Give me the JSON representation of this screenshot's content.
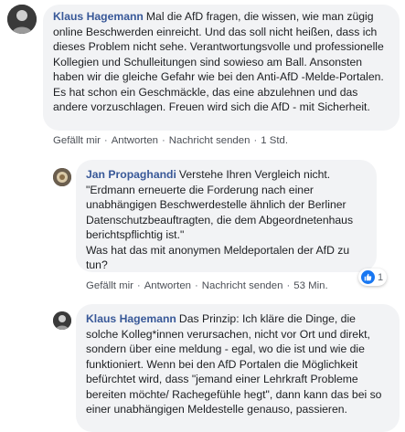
{
  "comments": [
    {
      "author": "Klaus Hagemann",
      "text": "Mal die AfD fragen, die wissen, wie man zügig online Beschwerden einreicht. Und das soll nicht heißen, dass ich dieses Problem nicht sehe. Verantwortungsvolle und professionelle Kollegien und Schulleitungen sind sowieso am Ball. Ansonsten haben wir die gleiche Gefahr wie bei den Anti-AfD -Melde-Portalen. Es hat schon ein Geschmäckle, das eine abzulehnen und das andere vorzuschlagen. Freuen wird sich die AfD - mit Sicherheit.",
      "like": "Gefällt mir",
      "reply": "Antworten",
      "message": "Nachricht senden",
      "time": "1 Std."
    },
    {
      "author": "Jan Propaghandi",
      "text": "Verstehe Ihren Vergleich nicht.\n\"Erdmann erneuerte die Forderung nach einer unabhängigen Beschwerdestelle ähnlich der Berliner Datenschutzbeauftragten, die dem Abgeordnetenhaus berichtspflichtig ist.\"\nWas hat das mit anonymen Meldeportalen der AfD zu tun?",
      "like": "Gefällt mir",
      "reply": "Antworten",
      "message": "Nachricht senden",
      "time": "53 Min.",
      "reaction_count": "1",
      "reaction_icon": "like-icon"
    },
    {
      "author": "Klaus Hagemann",
      "text": "Das Prinzip: Ich kläre die Dinge, die solche Kolleg*innen verursachen, nicht vor Ort und direkt, sondern über eine meldung - egal, wo die ist und wie die funktioniert. Wenn bei den AfD Portalen die Möglichkeit befürchtet wird, dass \"jemand einer Lehrkraft Probleme bereiten möchte/ Rachegefühle hegt\", dann kann das bei so einer unabhängigen Meldestelle genauso, passieren."
    }
  ],
  "separator": "·",
  "colors": {
    "link": "#385898",
    "bubble": "#f2f3f5",
    "like_blue": "#1877f2"
  }
}
